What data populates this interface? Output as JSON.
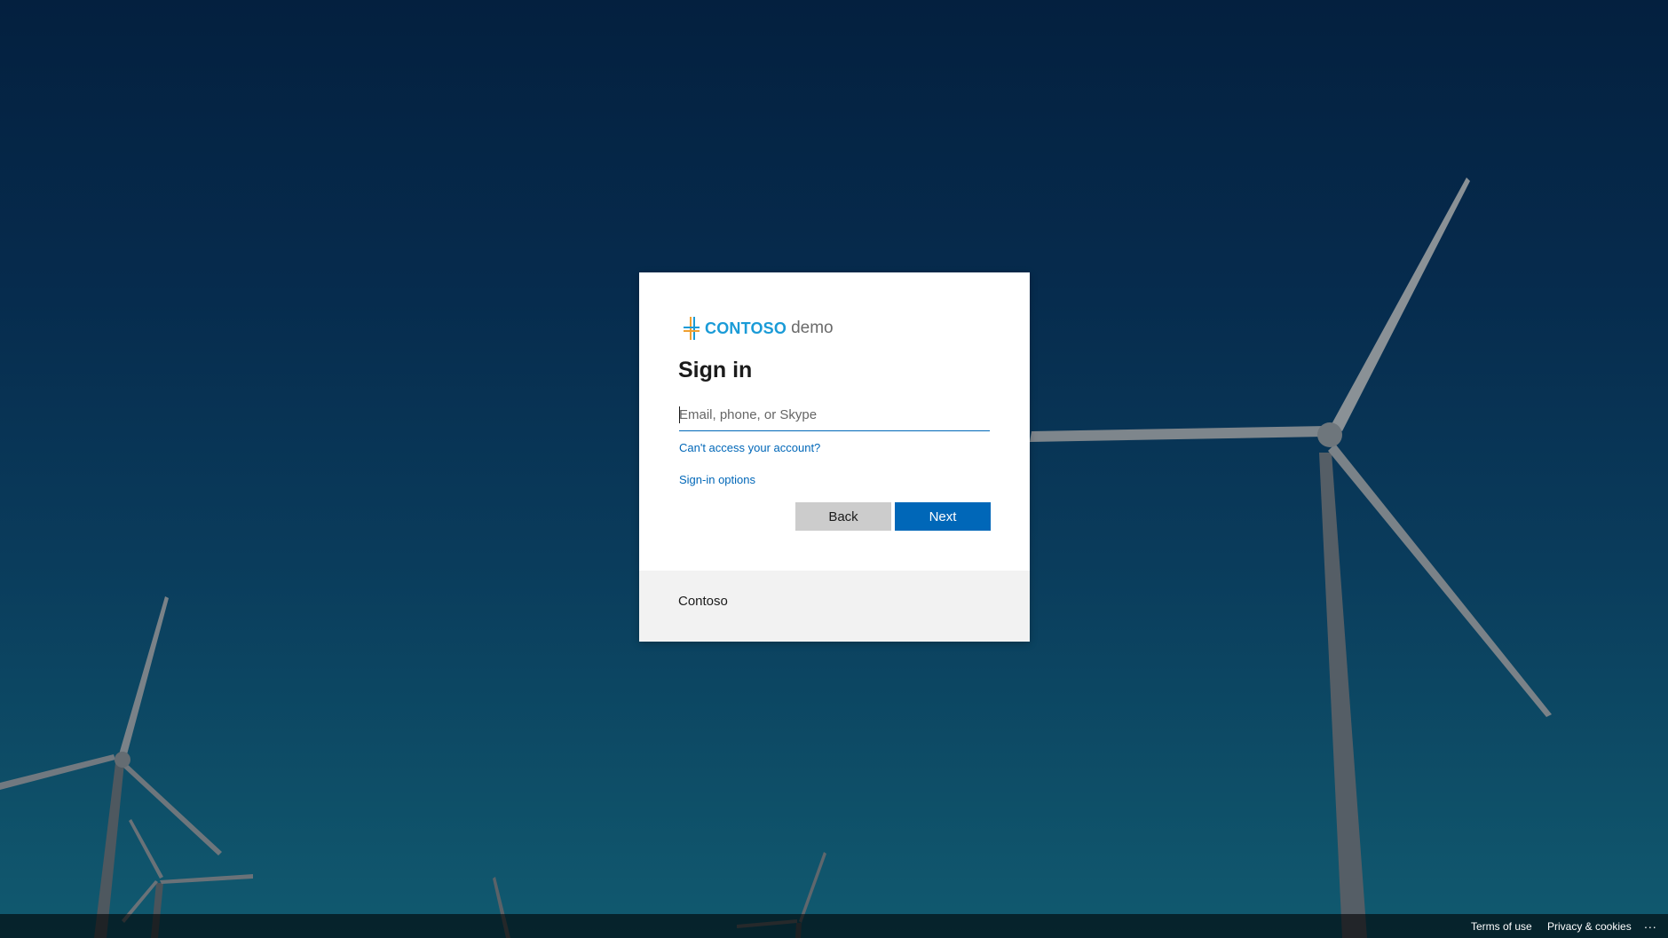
{
  "brand": {
    "name": "CONTOSO",
    "suffix": "demo",
    "colors": {
      "brand_blue": "#1a9bd7",
      "mark_orange": "#f0a030",
      "mark_blue": "#1a9bd7"
    },
    "logo_icon": "contoso-cross-logo"
  },
  "signin": {
    "title": "Sign in",
    "email_value": "",
    "email_placeholder": "Email, phone, or Skype",
    "cant_access_link": "Can't access your account?",
    "options_link": "Sign-in options",
    "back_label": "Back",
    "next_label": "Next"
  },
  "footer": {
    "org_name": "Contoso"
  },
  "bottom_bar": {
    "terms": "Terms of use",
    "privacy": "Privacy & cookies",
    "more": "..."
  },
  "theme": {
    "accent": "#0067b8",
    "secondary_button": "#cccccc",
    "footer_bg": "#f2f2f2",
    "background_image": "wind-turbines-night"
  }
}
